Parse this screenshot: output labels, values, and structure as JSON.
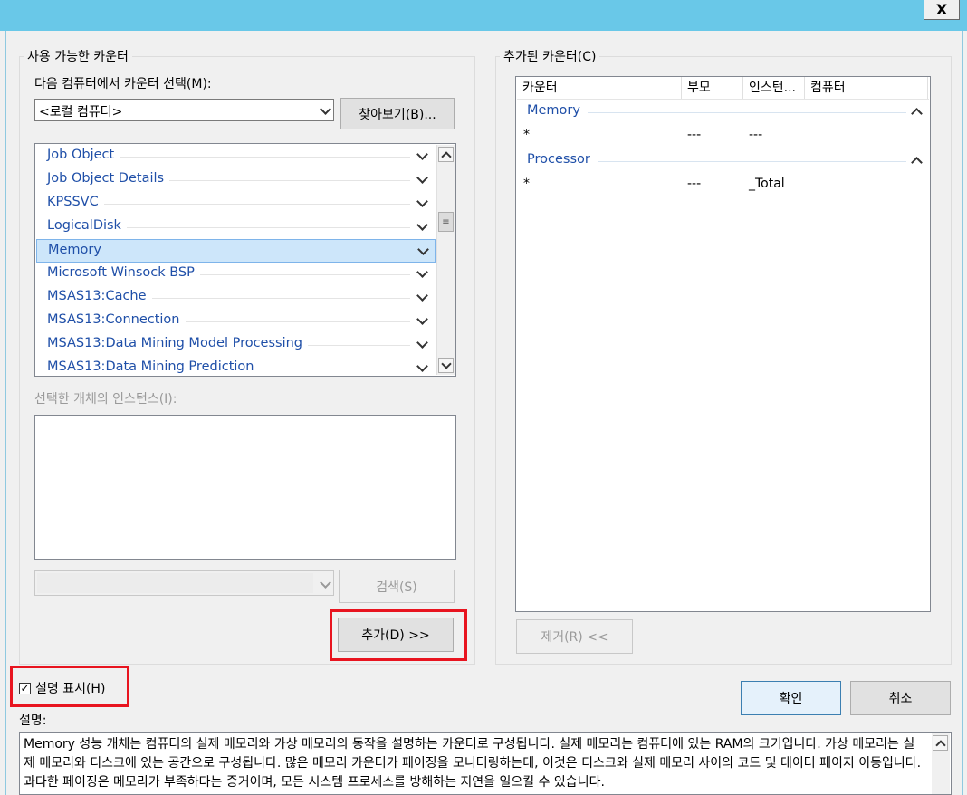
{
  "titlebar": {
    "close_glyph": "X"
  },
  "left_group": {
    "title": "사용 가능한 카운터",
    "select_computer_label": "다음 컴퓨터에서 카운터 선택(M):",
    "computer_value": "<로컬 컴퓨터>",
    "browse_button": "찾아보기(B)...",
    "objects": [
      {
        "name": "Job Object",
        "selected": false
      },
      {
        "name": "Job Object Details",
        "selected": false
      },
      {
        "name": "KPSSVC",
        "selected": false
      },
      {
        "name": "LogicalDisk",
        "selected": false
      },
      {
        "name": "Memory",
        "selected": true
      },
      {
        "name": "Microsoft Winsock BSP",
        "selected": false
      },
      {
        "name": "MSAS13:Cache",
        "selected": false
      },
      {
        "name": "MSAS13:Connection",
        "selected": false
      },
      {
        "name": "MSAS13:Data Mining Model Processing",
        "selected": false
      },
      {
        "name": "MSAS13:Data Mining Prediction",
        "selected": false
      }
    ],
    "instances_label": "선택한 개체의 인스턴스(I):",
    "search_button": "검색(S)",
    "add_button": "추가(D) >>"
  },
  "right_group": {
    "title": "추가된 카운터(C)",
    "columns": [
      "카운터",
      "부모",
      "인스턴...",
      "컴퓨터"
    ],
    "groups": [
      {
        "name": "Memory",
        "rows": [
          {
            "counter": "*",
            "parent": "---",
            "instance": "---",
            "computer": ""
          }
        ]
      },
      {
        "name": "Processor",
        "rows": [
          {
            "counter": "*",
            "parent": "---",
            "instance": "_Total",
            "computer": ""
          }
        ]
      }
    ],
    "remove_button": "제거(R) <<"
  },
  "show_description": {
    "label": "설명 표시(H)",
    "checked": true,
    "check_glyph": "✓"
  },
  "ok_button": "확인",
  "cancel_button": "취소",
  "description": {
    "label": "설명:",
    "text": "Memory 성능 개체는 컴퓨터의 실제 메모리와 가상 메모리의 동작을 설명하는 카운터로 구성됩니다. 실제 메모리는 컴퓨터에 있는 RAM의 크기입니다. 가상 메모리는 실제 메모리와 디스크에 있는 공간으로 구성됩니다. 많은 메모리 카운터가 페이징을 모니터링하는데, 이것은 디스크와 실제 메모리 사이의 코드 및 데이터 페이지 이동입니다. 과다한 페이징은 메모리가 부족하다는 증거이며, 모든 시스템 프로세스를 방해하는 지연을 일으킬 수 있습니다."
  },
  "colors": {
    "accent": "#69c8e8",
    "link": "#1f4fa8",
    "highlight": "#e8141f",
    "selection": "#cde6fa"
  }
}
